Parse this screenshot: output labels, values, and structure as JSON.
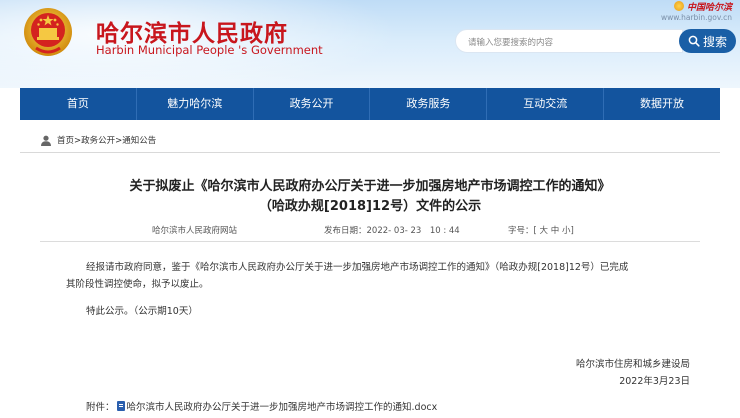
{
  "header": {
    "title_cn": "哈尔滨市人民政府",
    "title_en": "Harbin Municipal People 's Government",
    "brand_name": "中国哈尔滨",
    "brand_url": "www.harbin.gov.cn",
    "search_placeholder": "请输入您要搜索的内容",
    "search_button": "搜索"
  },
  "nav": [
    {
      "label": "首页"
    },
    {
      "label": "魅力哈尔滨"
    },
    {
      "label": "政务公开"
    },
    {
      "label": "政务服务"
    },
    {
      "label": "互动交流"
    },
    {
      "label": "数据开放"
    }
  ],
  "breadcrumb": {
    "home": "首页",
    "sep1": ">",
    "level2": "政务公开",
    "sep2": ">",
    "level3": "通知公告"
  },
  "article": {
    "title_line1": "关于拟废止《哈尔滨市人民政府办公厅关于进一步加强房地产市场调控工作的通知》",
    "title_line2": "（哈政办规[2018]12号）文件的公示",
    "source": "哈尔滨市人民政府网站",
    "date_label": "发布日期：",
    "date_value": "2022- 03- 23　10 : 44",
    "font_label": "字号：[",
    "font_large": "大",
    "font_medium": "中",
    "font_small": "小",
    "font_close": "]",
    "para1_line1": "经报请市政府同意，鉴于《哈尔滨市人民政府办公厅关于进一步加强房地产市场调控工作的通知》（哈政办规[2018]12号）已完成",
    "para1_line2": "其阶段性调控使命，拟予以废止。",
    "para2": "特此公示。（公示期10天）",
    "signoff_org": "哈尔滨市住房和城乡建设局",
    "signoff_date": "2022年3月23日",
    "attachment_label": "附件：",
    "attachment_name": "哈尔滨市人民政府办公厅关于进一步加强房地产市场调控工作的通知.docx"
  },
  "colors": {
    "brand_red": "#c8161d",
    "nav_blue": "#13549e",
    "search_blue": "#1a5fa6"
  }
}
